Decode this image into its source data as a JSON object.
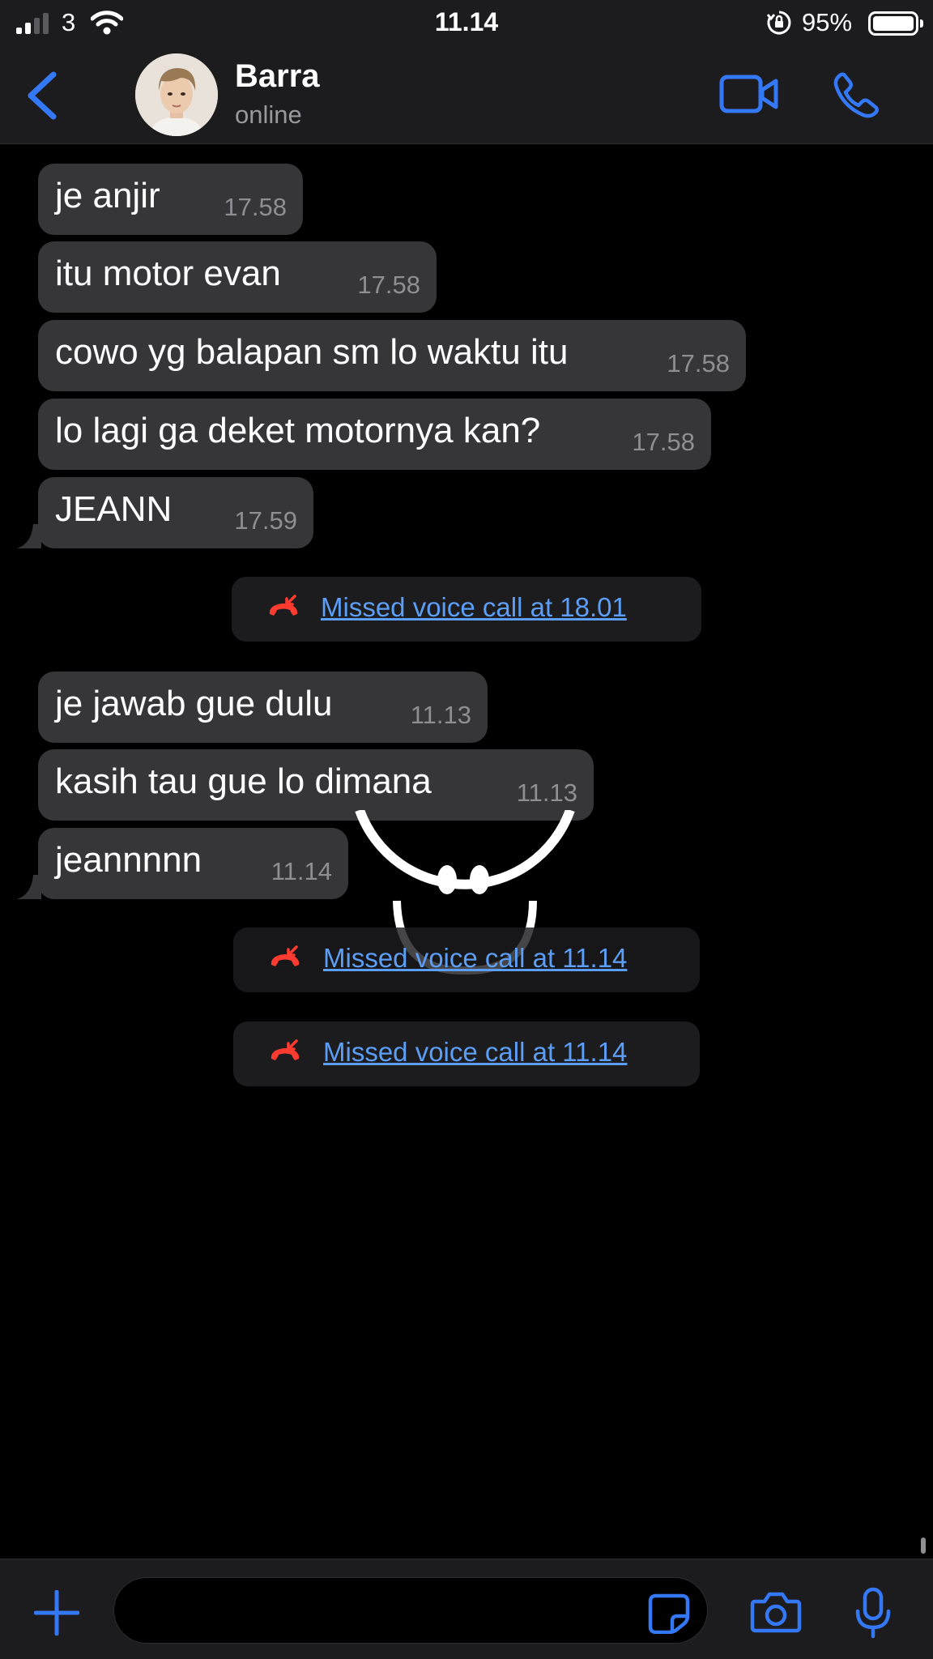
{
  "status_bar": {
    "carrier": "3",
    "time": "11.14",
    "battery": "95%",
    "battery_level": 0.95
  },
  "header": {
    "contact_name": "Barra",
    "contact_status": "online"
  },
  "messages": [
    {
      "text": "je anjir",
      "time": "17.58"
    },
    {
      "text": "itu motor evan",
      "time": "17.58"
    },
    {
      "text": "cowo yg balapan sm lo waktu itu",
      "time": "17.58"
    },
    {
      "text": "lo lagi ga deket motornya kan?",
      "time": "17.58"
    },
    {
      "text": "JEANN",
      "time": "17.59"
    },
    {
      "text": "je jawab gue dulu",
      "time": "11.13"
    },
    {
      "text": "kasih tau gue lo dimana",
      "time": "11.13"
    },
    {
      "text": "jeannnnn",
      "time": "11.14"
    }
  ],
  "system_messages": [
    {
      "text": "Missed voice call at 18.01"
    },
    {
      "text": "Missed voice call at 11.14"
    },
    {
      "text": "Missed voice call at 11.14"
    }
  ],
  "icons": [
    "chevron-left-icon",
    "video-icon",
    "phone-icon",
    "missed-call-icon",
    "plus-icon",
    "sticker-icon",
    "camera-icon",
    "microphone-icon"
  ],
  "colors": {
    "accent": "#3478f6",
    "link": "#5c9ef5",
    "missed_call": "#ff3b30",
    "bubble": "#363638",
    "bar_bg": "#1c1c1e"
  }
}
